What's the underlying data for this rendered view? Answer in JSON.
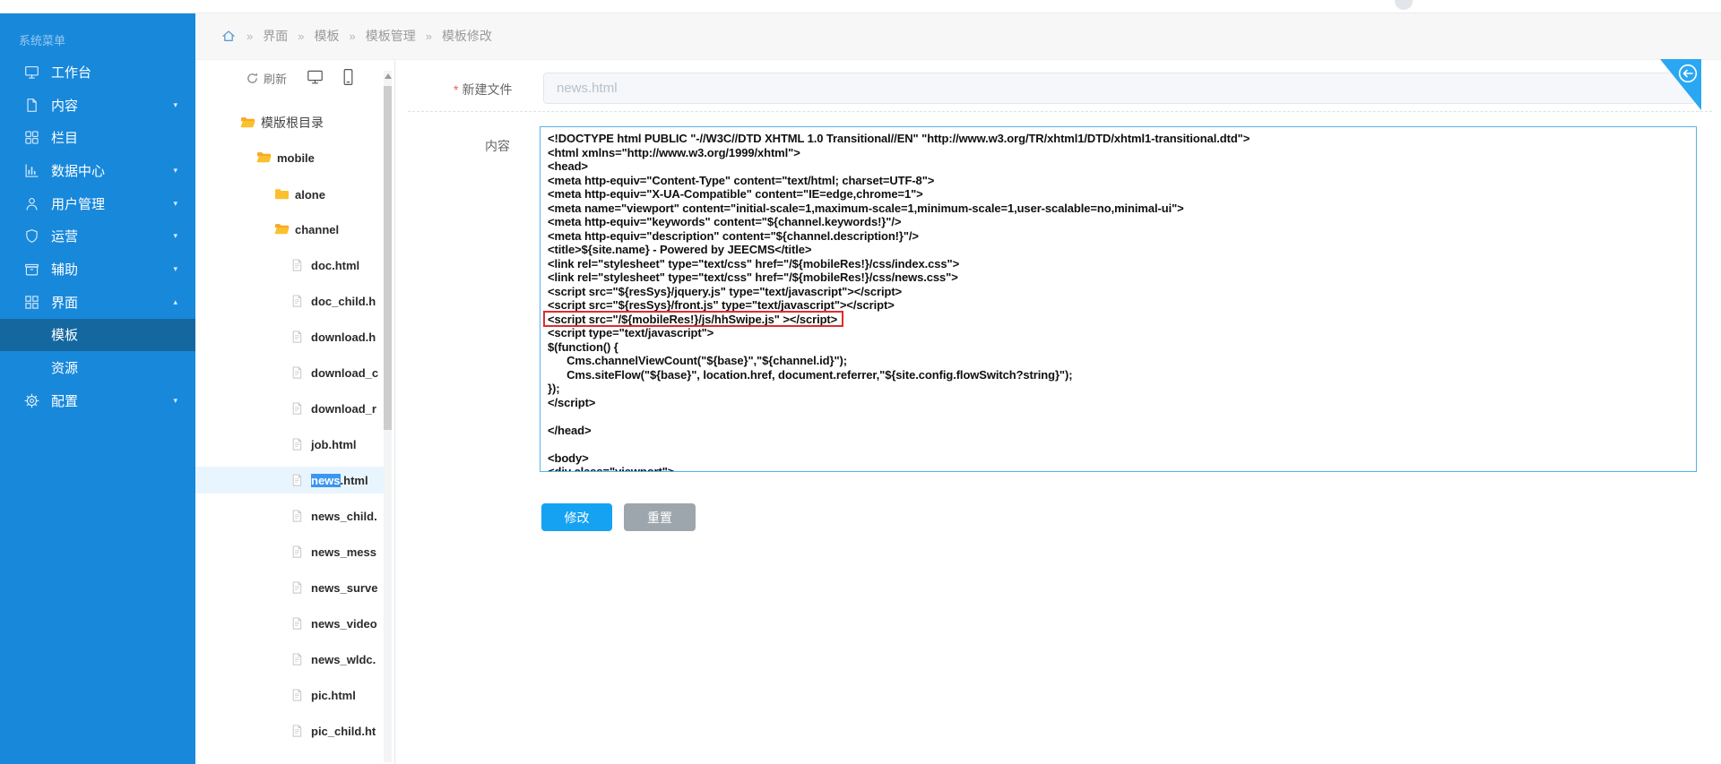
{
  "colors": {
    "sidebar": "#1888db",
    "sidebar_active": "#15679f",
    "folder_yellow": "#fbc02d",
    "selection_row": "#e9f5fe",
    "text_selection": "#3b96f2",
    "button_primary": "#16a2f3",
    "button_secondary": "#9ea6ad",
    "red_box": "#e02b2b",
    "fold_triangle": "#2aa7f2",
    "textarea_border": "#56b2ef"
  },
  "sidebar": {
    "header": "系统菜单",
    "items": [
      {
        "key": "workbench",
        "label": "工作台",
        "icon": "monitor-icon",
        "arrow": ""
      },
      {
        "key": "content",
        "label": "内容",
        "icon": "document-icon",
        "arrow": "down"
      },
      {
        "key": "columns",
        "label": "栏目",
        "icon": "grid-icon",
        "arrow": ""
      },
      {
        "key": "data-center",
        "label": "数据中心",
        "icon": "chart-icon",
        "arrow": "down"
      },
      {
        "key": "user-management",
        "label": "用户管理",
        "icon": "user-icon",
        "arrow": "down"
      },
      {
        "key": "operations",
        "label": "运营",
        "icon": "shield-icon",
        "arrow": "down"
      },
      {
        "key": "auxiliary",
        "label": "辅助",
        "icon": "box-icon",
        "arrow": "down"
      },
      {
        "key": "interface",
        "label": "界面",
        "icon": "layout-icon",
        "arrow": "up"
      },
      {
        "key": "template",
        "label": "模板",
        "sub": true,
        "active": true
      },
      {
        "key": "resources",
        "label": "资源",
        "sub": true
      },
      {
        "key": "config",
        "label": "配置",
        "icon": "gear-icon",
        "arrow": "down"
      }
    ]
  },
  "breadcrumb": {
    "separator": "»",
    "items": [
      "界面",
      "模板",
      "模板管理",
      "模板修改"
    ]
  },
  "tree": {
    "refresh_label": "刷新",
    "nodes": [
      {
        "label": "模版根目录",
        "type": "folder-open",
        "depth": 0,
        "root": true
      },
      {
        "label": "mobile",
        "type": "folder-open",
        "depth": 1
      },
      {
        "label": "alone",
        "type": "folder",
        "depth": 2
      },
      {
        "label": "channel",
        "type": "folder-open",
        "depth": 2
      },
      {
        "label": "doc.html",
        "type": "file",
        "depth": 3
      },
      {
        "label": "doc_child.h",
        "type": "file",
        "depth": 3
      },
      {
        "label": "download.h",
        "type": "file",
        "depth": 3
      },
      {
        "label": "download_c",
        "type": "file",
        "depth": 3
      },
      {
        "label": "download_r",
        "type": "file",
        "depth": 3
      },
      {
        "label": "job.html",
        "type": "file",
        "depth": 3
      },
      {
        "label": "news.html",
        "type": "file",
        "depth": 3,
        "selected": true,
        "hl": "news",
        "rest": ".html"
      },
      {
        "label": "news_child.",
        "type": "file",
        "depth": 3
      },
      {
        "label": "news_mess",
        "type": "file",
        "depth": 3
      },
      {
        "label": "news_surve",
        "type": "file",
        "depth": 3
      },
      {
        "label": "news_video",
        "type": "file",
        "depth": 3
      },
      {
        "label": "news_wldc.",
        "type": "file",
        "depth": 3
      },
      {
        "label": "pic.html",
        "type": "file",
        "depth": 3
      },
      {
        "label": "pic_child.ht",
        "type": "file",
        "depth": 3
      }
    ]
  },
  "form": {
    "required_mark": "*",
    "filename_label": "新建文件",
    "filename_value": "news.html",
    "content_label": "内容",
    "modify_label": "修改",
    "reset_label": "重置"
  },
  "code": {
    "red_box_line": 14,
    "lines": [
      "<!DOCTYPE html PUBLIC \"-//W3C//DTD XHTML 1.0 Transitional//EN\" \"http://www.w3.org/TR/xhtml1/DTD/xhtml1-transitional.dtd\">",
      "<html xmlns=\"http://www.w3.org/1999/xhtml\">",
      "<head>",
      "<meta http-equiv=\"Content-Type\" content=\"text/html; charset=UTF-8\">",
      "<meta http-equiv=\"X-UA-Compatible\" content=\"IE=edge,chrome=1\">",
      "<meta name=\"viewport\" content=\"initial-scale=1,maximum-scale=1,minimum-scale=1,user-scalable=no,minimal-ui\">",
      "<meta http-equiv=\"keywords\" content=\"${channel.keywords!}\"/>",
      "<meta http-equiv=\"description\" content=\"${channel.description!}\"/>",
      "<title>${site.name} - Powered by JEECMS</title>",
      "<link rel=\"stylesheet\" type=\"text/css\" href=\"/${mobileRes!}/css/index.css\">",
      "<link rel=\"stylesheet\" type=\"text/css\" href=\"/${mobileRes!}/css/news.css\">",
      "<script src=\"${resSys}/jquery.js\" type=\"text/javascript\"></script>",
      "<script src=\"${resSys}/front.js\" type=\"text/javascript\"></script>",
      "<script src=\"/${mobileRes!}/js/hhSwipe.js\" ></script>",
      "<script type=\"text/javascript\">",
      "$(function() {",
      "      Cms.channelViewCount(\"${base}\",\"${channel.id}\");",
      "      Cms.siteFlow(\"${base}\", location.href, document.referrer,\"${site.config.flowSwitch?string}\");",
      "});",
      "</script>",
      "",
      "</head>",
      "",
      "<body>",
      "<div class=\"viewport\">"
    ]
  }
}
